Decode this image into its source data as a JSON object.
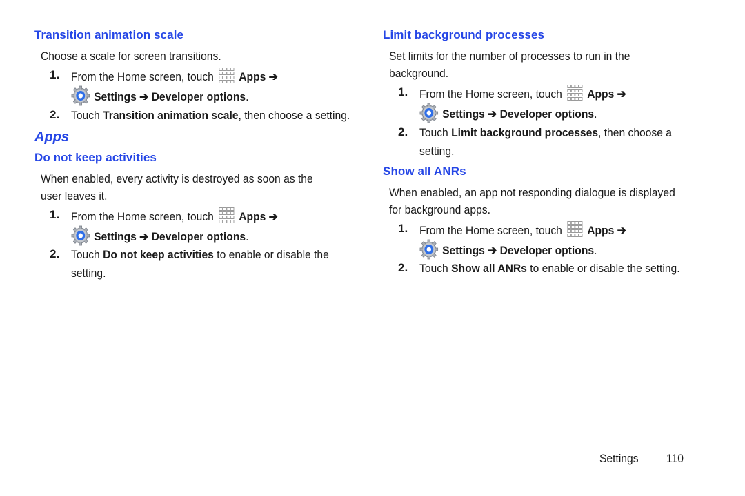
{
  "colors": {
    "heading": "#2546e6",
    "text": "#1a1a1a"
  },
  "step1": {
    "prefix": "From the Home screen, touch",
    "apps_icon": "apps-grid-icon",
    "apps": "Apps",
    "arrow": "➔",
    "settings_icon": "settings-gear-icon",
    "settings": "Settings",
    "developer_options": "Developer options",
    "period": "."
  },
  "left": {
    "transition": {
      "heading": "Transition animation scale",
      "description": "Choose a scale for screen transitions.",
      "step1_num": "1.",
      "step2_num": "2.",
      "step2_pre": "Touch ",
      "step2_bold": "Transition animation scale",
      "step2_post": ", then choose a setting."
    },
    "section_title": "Apps",
    "do_not_keep": {
      "heading": "Do not keep activities",
      "description_line1": "When enabled, every activity is destroyed as soon as the",
      "description_line2": "user leaves it.",
      "step1_num": "1.",
      "step2_num": "2.",
      "step2_pre": "Touch ",
      "step2_bold": "Do not keep activities",
      "step2_post": " to enable or disable the",
      "step2_line2": "setting."
    }
  },
  "right": {
    "limit_bg": {
      "heading": "Limit background processes",
      "description_line1": "Set limits for the number of processes to run in the",
      "description_line2": "background.",
      "step1_num": "1.",
      "step2_num": "2.",
      "step2_pre": "Touch ",
      "step2_bold": "Limit background processes",
      "step2_post": ", then choose a",
      "step2_line2": "setting."
    },
    "show_anrs": {
      "heading": "Show all ANRs",
      "description_line1": "When enabled, an app not responding dialogue is displayed",
      "description_line2": "for background apps.",
      "step1_num": "1.",
      "step2_num": "2.",
      "step2_pre": "Touch ",
      "step2_bold": "Show all ANRs",
      "step2_post": " to enable or disable the setting."
    }
  },
  "footer": {
    "section": "Settings",
    "page": "110"
  }
}
